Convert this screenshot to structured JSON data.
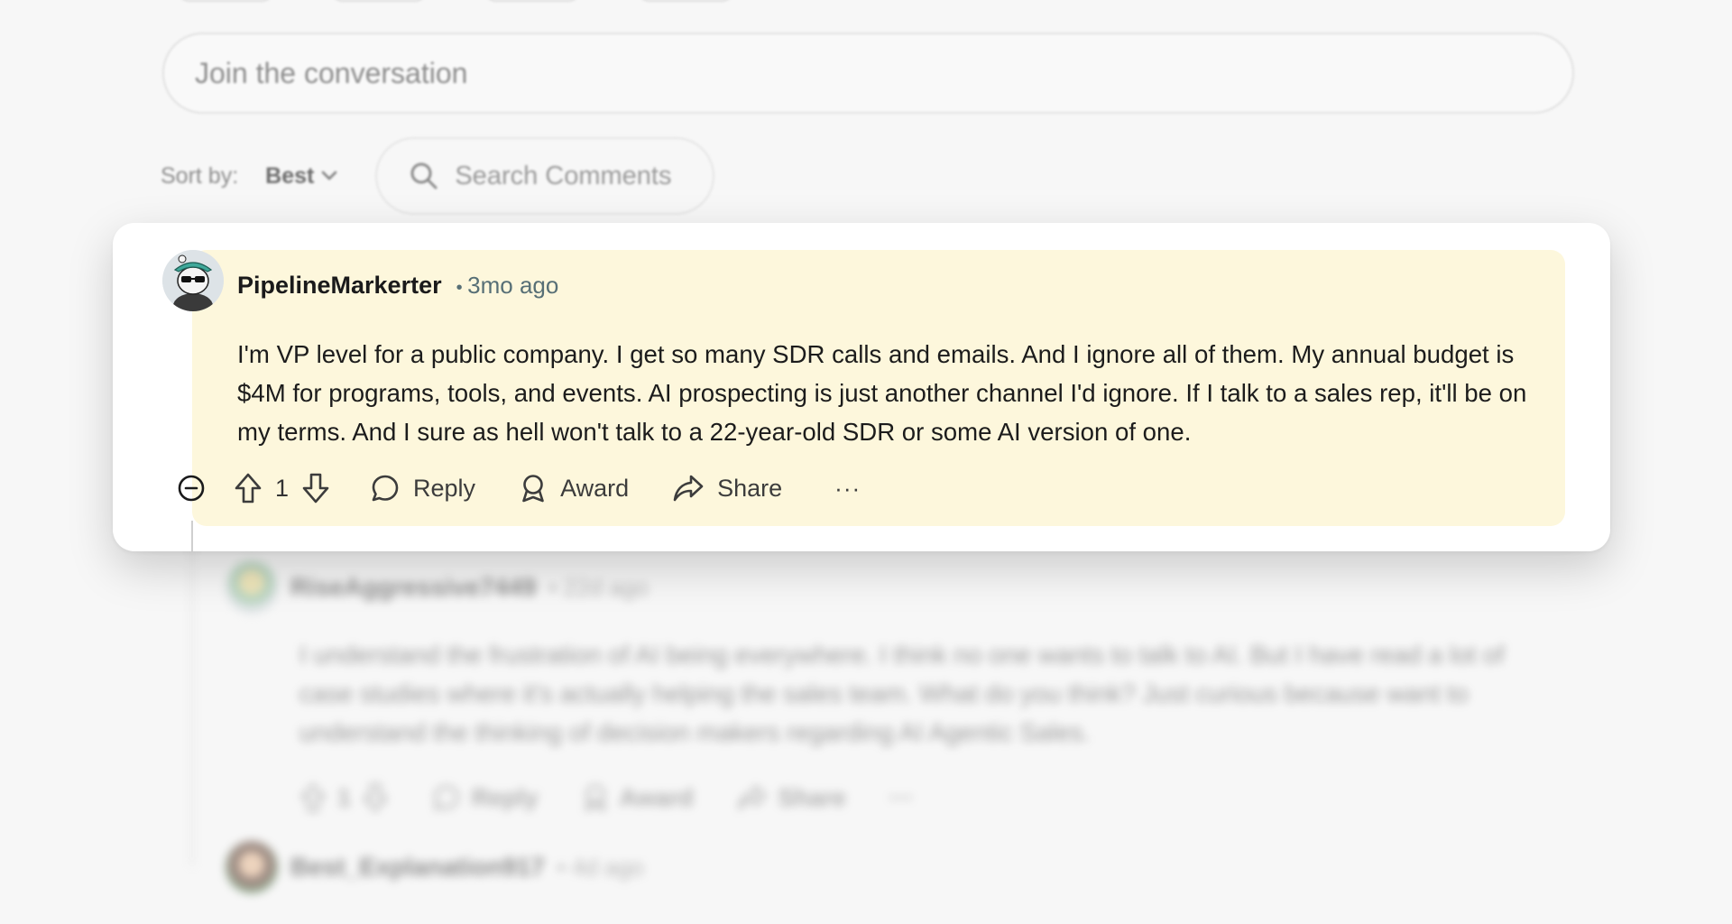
{
  "composer": {
    "placeholder": "Join the conversation"
  },
  "sort": {
    "label": "Sort by:",
    "value": "Best"
  },
  "search": {
    "placeholder": "Search Comments"
  },
  "focused_comment": {
    "username": "PipelineMarkerter",
    "age": "3mo ago",
    "body": "I'm VP level for a public company. I get so many SDR calls and emails. And I ignore all of them. My annual budget is $4M for programs, tools, and events. AI prospecting is just another channel I'd ignore. If I talk to a sales rep, it'll be on my terms. And I sure as hell won't talk to a 22-year-old SDR or some AI version of one.",
    "votes": "1",
    "actions": {
      "reply": "Reply",
      "award": "Award",
      "share": "Share",
      "more": "···"
    },
    "highlight_color": "#fdf7dc"
  },
  "replies": [
    {
      "username": "RiseAggressive7449",
      "age": "• 22d ago",
      "body": "I understand the frustration of AI being everywhere. I think no one wants to talk to AI. But I have read a lot of case studies where it's actually helping the sales team. What do you think? Just curious because want to understand the thinking of decision makers regarding AI Agentic Sales.",
      "votes": "1",
      "actions": {
        "reply": "Reply",
        "award": "Award",
        "share": "Share",
        "more": "···"
      }
    },
    {
      "username": "Best_Explanation917",
      "age": "• 4d ago"
    }
  ]
}
